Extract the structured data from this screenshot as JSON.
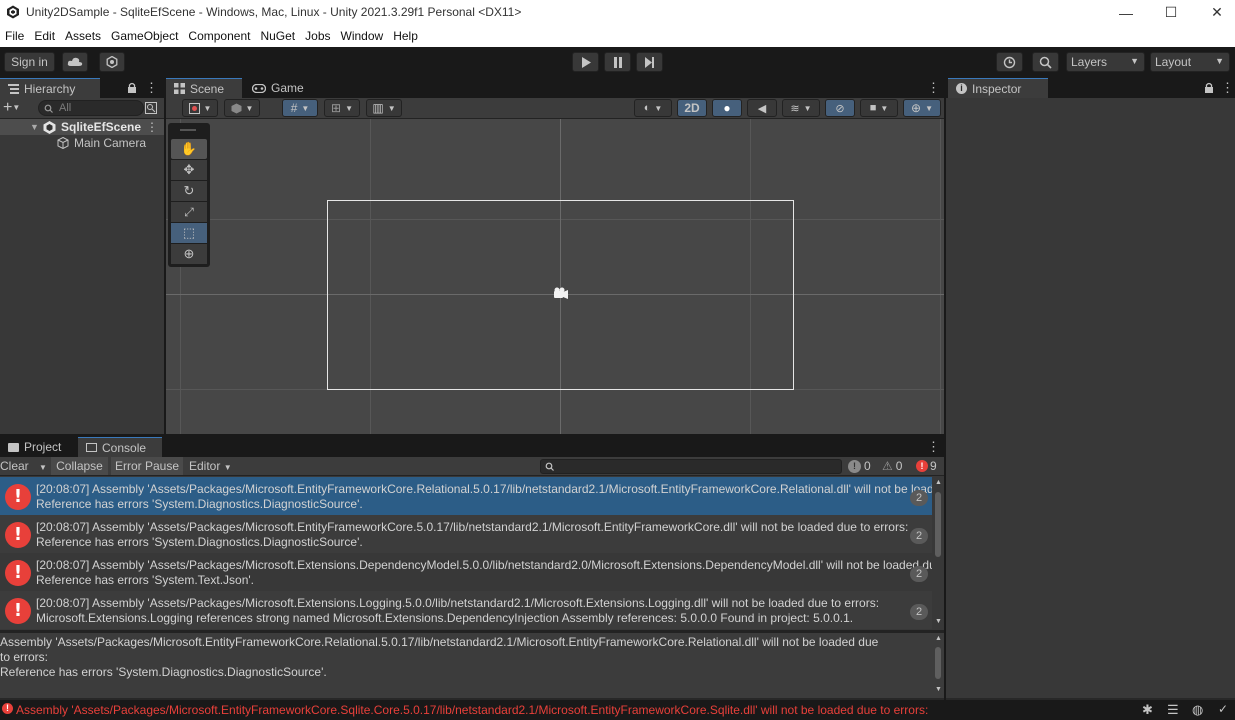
{
  "window": {
    "title": "Unity2DSample - SqliteEfScene - Windows, Mac, Linux - Unity 2021.3.29f1 Personal <DX11>",
    "minimize": "—",
    "maximize": "☐",
    "close": "✕"
  },
  "menu": [
    "File",
    "Edit",
    "Assets",
    "GameObject",
    "Component",
    "NuGet",
    "Jobs",
    "Window",
    "Help"
  ],
  "toolbar": {
    "sign_in": "Sign in",
    "layers": "Layers",
    "layout": "Layout"
  },
  "hierarchy": {
    "tab": "Hierarchy",
    "search_placeholder": "All",
    "scene": "SqliteEfScene",
    "items": [
      "Main Camera"
    ]
  },
  "scene_panel": {
    "tabs": [
      "Scene",
      "Game"
    ],
    "mode_2d": "2D"
  },
  "inspector": {
    "tab": "Inspector"
  },
  "console": {
    "tabs": [
      "Project",
      "Console"
    ],
    "buttons": {
      "clear": "Clear",
      "collapse": "Collapse",
      "error_pause": "Error Pause",
      "editor": "Editor"
    },
    "counts": {
      "info": "0",
      "warn": "0",
      "error": "9"
    },
    "logs": [
      {
        "line1": "[20:08:07] Assembly 'Assets/Packages/Microsoft.EntityFrameworkCore.Relational.5.0.17/lib/netstandard2.1/Microsoft.EntityFrameworkCore.Relational.dll' will not be loaded due to errors:",
        "line2": "Reference has errors 'System.Diagnostics.DiagnosticSource'.",
        "count": "2",
        "selected": true
      },
      {
        "line1": "[20:08:07] Assembly 'Assets/Packages/Microsoft.EntityFrameworkCore.5.0.17/lib/netstandard2.1/Microsoft.EntityFrameworkCore.dll' will not be loaded due to errors:",
        "line2": "Reference has errors 'System.Diagnostics.DiagnosticSource'.",
        "count": "2",
        "selected": false
      },
      {
        "line1": "[20:08:07] Assembly 'Assets/Packages/Microsoft.Extensions.DependencyModel.5.0.0/lib/netstandard2.0/Microsoft.Extensions.DependencyModel.dll' will not be loaded due to errors:",
        "line2": "Reference has errors 'System.Text.Json'.",
        "count": "2",
        "selected": false
      },
      {
        "line1": "[20:08:07] Assembly 'Assets/Packages/Microsoft.Extensions.Logging.5.0.0/lib/netstandard2.1/Microsoft.Extensions.Logging.dll' will not be loaded due to errors:",
        "line2": "Microsoft.Extensions.Logging references strong named Microsoft.Extensions.DependencyInjection Assembly references: 5.0.0.0 Found in project: 5.0.0.1.",
        "count": "2",
        "selected": false
      }
    ],
    "detail": [
      "Assembly 'Assets/Packages/Microsoft.EntityFrameworkCore.Relational.5.0.17/lib/netstandard2.1/Microsoft.EntityFrameworkCore.Relational.dll' will not be loaded due",
      "to errors:",
      "Reference has errors 'System.Diagnostics.DiagnosticSource'."
    ]
  },
  "status": {
    "message": "Assembly 'Assets/Packages/Microsoft.EntityFrameworkCore.Sqlite.Core.5.0.17/lib/netstandard2.1/Microsoft.EntityFrameworkCore.Sqlite.dll' will not be loaded due to errors:"
  },
  "colors": {
    "accent": "#3a79bb",
    "error": "#e8403a",
    "panel": "#383838",
    "toolbar": "#191919",
    "selection": "#2c5d87"
  }
}
